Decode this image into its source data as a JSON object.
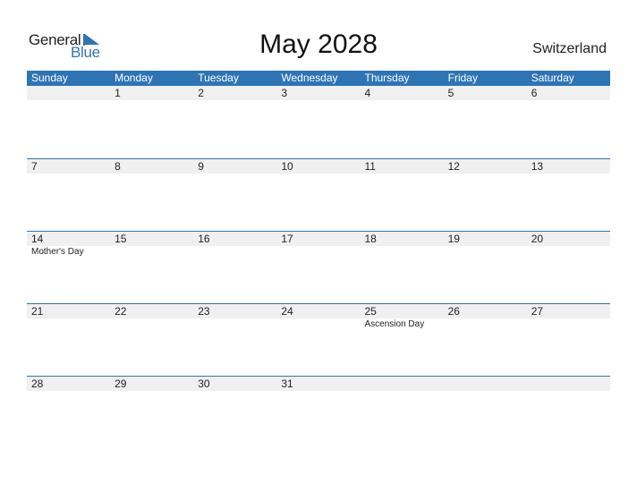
{
  "logo": {
    "text_1": "General",
    "text_2": "Blue"
  },
  "title": "May 2028",
  "country": "Switzerland",
  "weekdays": [
    "Sunday",
    "Monday",
    "Tuesday",
    "Wednesday",
    "Thursday",
    "Friday",
    "Saturday"
  ],
  "weeks": [
    {
      "days": [
        "",
        "1",
        "2",
        "3",
        "4",
        "5",
        "6"
      ],
      "events": [
        "",
        "",
        "",
        "",
        "",
        "",
        ""
      ]
    },
    {
      "days": [
        "7",
        "8",
        "9",
        "10",
        "11",
        "12",
        "13"
      ],
      "events": [
        "",
        "",
        "",
        "",
        "",
        "",
        ""
      ]
    },
    {
      "days": [
        "14",
        "15",
        "16",
        "17",
        "18",
        "19",
        "20"
      ],
      "events": [
        "Mother's Day",
        "",
        "",
        "",
        "",
        "",
        ""
      ]
    },
    {
      "days": [
        "21",
        "22",
        "23",
        "24",
        "25",
        "26",
        "27"
      ],
      "events": [
        "",
        "",
        "",
        "",
        "Ascension Day",
        "",
        ""
      ]
    },
    {
      "days": [
        "28",
        "29",
        "30",
        "31",
        "",
        "",
        ""
      ],
      "events": [
        "",
        "",
        "",
        "",
        "",
        "",
        ""
      ]
    }
  ],
  "colors": {
    "accent": "#2e74b5",
    "strip": "#f0f0f0"
  }
}
